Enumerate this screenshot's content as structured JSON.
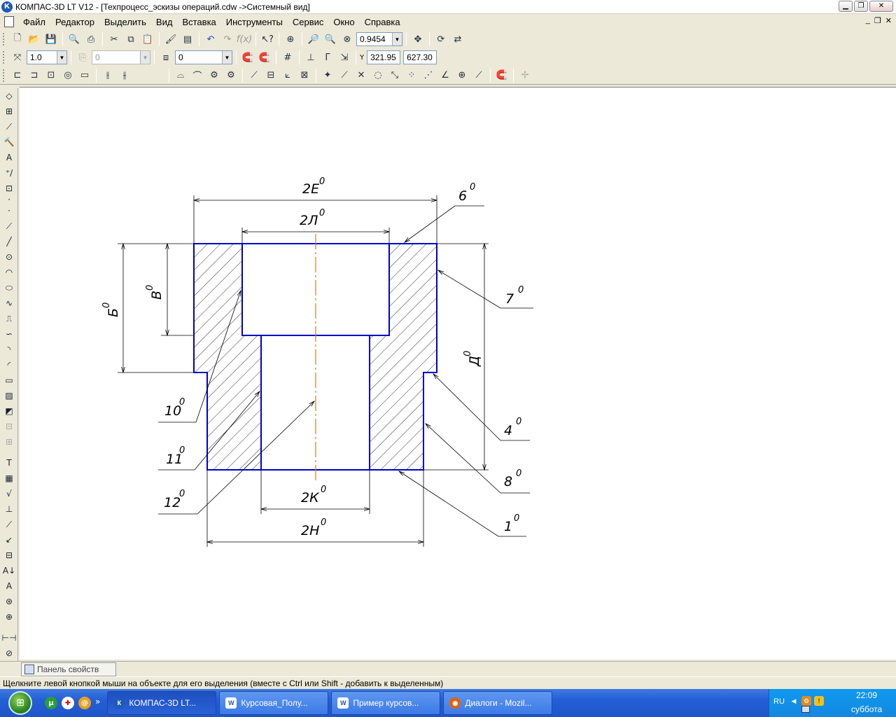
{
  "window": {
    "title": "КОМПАС-3D LT V12 - [Техпроцесс_эскизы операций.cdw ->Системный вид]",
    "logo_letter": "К"
  },
  "menu": [
    "Файл",
    "Редактор",
    "Выделить",
    "Вид",
    "Вставка",
    "Инструменты",
    "Сервис",
    "Окно",
    "Справка"
  ],
  "toolbar": {
    "zoom_value": "0.9454",
    "step_value": "1.0",
    "angle_value": "0",
    "layer_value": "0",
    "coord_x": "321.95",
    "coord_y": "627.30",
    "coord_label": "Y"
  },
  "drawing": {
    "dimension_labels": {
      "E": "2Е",
      "L": "2Л",
      "B": "Б",
      "V": "В",
      "D": "Д",
      "K": "2К",
      "H": "2Н"
    },
    "leader_labels": {
      "s6": "6",
      "s7": "7",
      "s4": "4",
      "s8": "8",
      "s1": "1",
      "s10": "10",
      "s11": "11",
      "s12": "12"
    },
    "superscript": "0",
    "outline_color": "#0000cc",
    "axis_color": "#e07a1a"
  },
  "panel": {
    "properties_tab": "Панель свойств"
  },
  "status": {
    "hint": "Щелкните левой кнопкой мыши на объекте для его выделения (вместе с Ctrl или Shift - добавить к выделенным)"
  },
  "taskbar": {
    "tasks": [
      {
        "label": "КОМПАС-3D LT...",
        "active": true
      },
      {
        "label": "Курсовая_Полу...",
        "active": false
      },
      {
        "label": "Пример курсов...",
        "active": false
      },
      {
        "label": "Диалоги - Mozil...",
        "active": false
      }
    ],
    "lang": "RU",
    "time": "22:09",
    "day": "суббота",
    "overflow": "»"
  }
}
